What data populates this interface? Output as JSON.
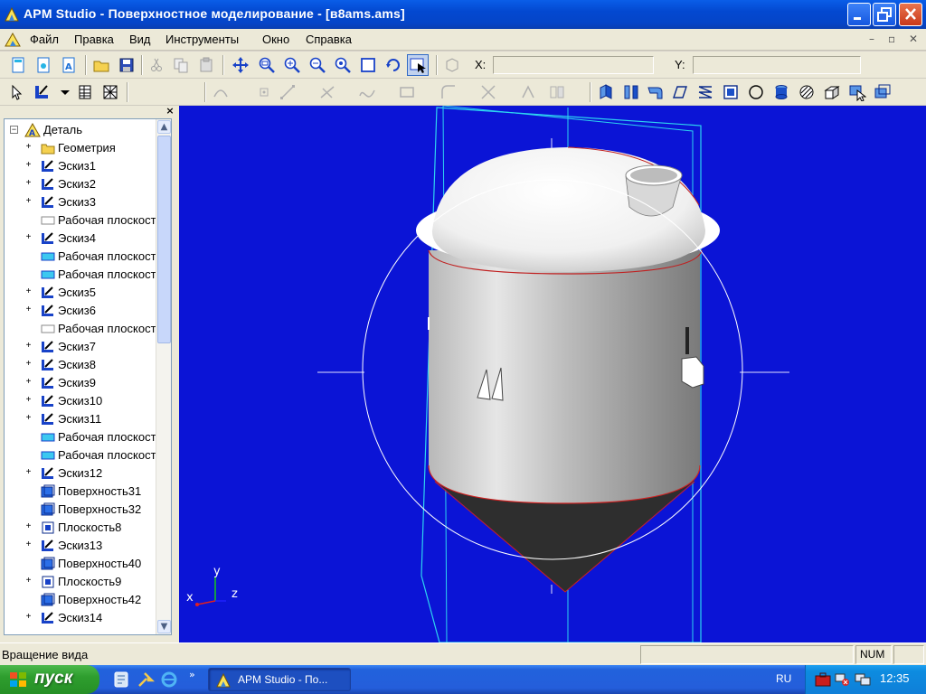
{
  "window": {
    "title": "APM Studio - Поверхностное моделирование - [в8ams.ams]"
  },
  "menu": {
    "items": [
      {
        "label": "Файл"
      },
      {
        "label": "Правка"
      },
      {
        "label": "Вид"
      },
      {
        "label": "Инструменты"
      },
      {
        "label": "Окно"
      },
      {
        "label": "Справка"
      }
    ]
  },
  "coords": {
    "x_label": "X:",
    "x_value": "",
    "y_label": "Y:",
    "y_value": ""
  },
  "tree": {
    "root_label": "Деталь",
    "items": [
      {
        "label": "Геометрия",
        "icon": "folder-icon",
        "expandable": true
      },
      {
        "label": "Эскиз1",
        "icon": "sketch-icon",
        "expandable": true
      },
      {
        "label": "Эскиз2",
        "icon": "sketch-icon",
        "expandable": true
      },
      {
        "label": "Эскиз3",
        "icon": "sketch-icon",
        "expandable": true
      },
      {
        "label": "Рабочая плоскость",
        "icon": "plane-empty-icon",
        "expandable": false
      },
      {
        "label": "Эскиз4",
        "icon": "sketch-icon",
        "expandable": true
      },
      {
        "label": "Рабочая плоскость",
        "icon": "plane-icon",
        "expandable": false
      },
      {
        "label": "Рабочая плоскость",
        "icon": "plane-icon",
        "expandable": false
      },
      {
        "label": "Эскиз5",
        "icon": "sketch-icon",
        "expandable": true
      },
      {
        "label": "Эскиз6",
        "icon": "sketch-icon",
        "expandable": true
      },
      {
        "label": "Рабочая плоскость",
        "icon": "plane-empty-icon",
        "expandable": false
      },
      {
        "label": "Эскиз7",
        "icon": "sketch-icon",
        "expandable": true
      },
      {
        "label": "Эскиз8",
        "icon": "sketch-icon",
        "expandable": true
      },
      {
        "label": "Эскиз9",
        "icon": "sketch-icon",
        "expandable": true
      },
      {
        "label": "Эскиз10",
        "icon": "sketch-icon",
        "expandable": true
      },
      {
        "label": "Эскиз11",
        "icon": "sketch-icon",
        "expandable": true
      },
      {
        "label": "Рабочая плоскость",
        "icon": "plane-icon",
        "expandable": false
      },
      {
        "label": "Рабочая плоскость",
        "icon": "plane-icon",
        "expandable": false
      },
      {
        "label": "Эскиз12",
        "icon": "sketch-icon",
        "expandable": true
      },
      {
        "label": "Поверхность31",
        "icon": "surface-icon",
        "expandable": false
      },
      {
        "label": "Поверхность32",
        "icon": "surface-icon",
        "expandable": false
      },
      {
        "label": "Плоскость8",
        "icon": "flat-surface-icon",
        "expandable": true
      },
      {
        "label": "Эскиз13",
        "icon": "sketch-icon",
        "expandable": true
      },
      {
        "label": "Поверхность40",
        "icon": "surface-icon",
        "expandable": false
      },
      {
        "label": "Плоскость9",
        "icon": "flat-surface-icon",
        "expandable": true
      },
      {
        "label": "Поверхность42",
        "icon": "surface-icon",
        "expandable": false
      },
      {
        "label": "Эскиз14",
        "icon": "sketch-icon",
        "expandable": true
      }
    ]
  },
  "viewport": {
    "background": "#0b14d6",
    "axis_labels": {
      "x": "x",
      "y": "y",
      "z": "z"
    }
  },
  "status": {
    "text": "Вращение вида",
    "num": "NUM"
  },
  "taskbar": {
    "start_label": "пуск",
    "task_label": "APM Studio - По...",
    "lang": "RU",
    "clock": "12:35"
  }
}
